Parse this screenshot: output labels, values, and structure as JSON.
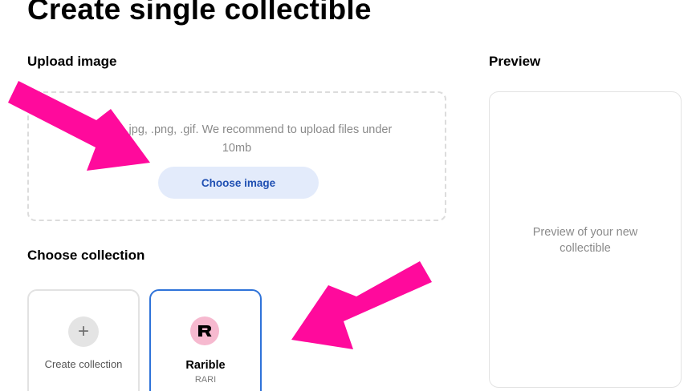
{
  "page": {
    "title": "Create single collectible"
  },
  "upload": {
    "label": "Upload image",
    "hint": "Support .jpg, .png, .gif. We recommend to upload files under 10mb",
    "button_label": "Choose image"
  },
  "preview": {
    "label": "Preview",
    "placeholder": "Preview of your new collectible"
  },
  "collection": {
    "label": "Choose collection",
    "cards": [
      {
        "icon": "plus-icon",
        "label": "Create collection"
      },
      {
        "icon": "rarible-logo-icon",
        "name": "Rarible",
        "ticker": "RARI"
      }
    ]
  },
  "annotations": {
    "arrow_color": "#ff0a9c"
  },
  "colors": {
    "accent_button_bg": "#e3ebfb",
    "accent_button_text": "#1f4fb2",
    "selected_border": "#2f73d9",
    "rarible_logo_bg": "#f6b9cf"
  }
}
